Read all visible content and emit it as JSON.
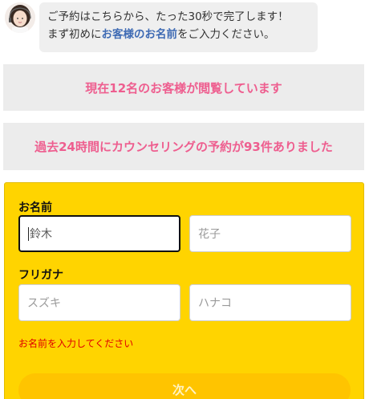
{
  "chat": {
    "avatar_icon": "operator-avatar-icon",
    "line1": "ご予約はこちらから、たった30秒で完了します！",
    "line2_prefix": "まず初めに",
    "line2_emphasis": "お客様のお名前",
    "line2_suffix": "をご入力ください。"
  },
  "notices": {
    "viewers": "現在12名のお客様が閲覧しています",
    "reservations": "過去24時間にカウンセリングの予約が93件ありました"
  },
  "form": {
    "name_label": "お名前",
    "last_name": {
      "value": "",
      "placeholder": "鈴木"
    },
    "first_name": {
      "value": "",
      "placeholder": "花子"
    },
    "kana_label": "フリガナ",
    "last_name_kana": {
      "value": "",
      "placeholder": "スズキ"
    },
    "first_name_kana": {
      "value": "",
      "placeholder": "ハナコ"
    },
    "error_message": "お名前を入力してください",
    "next_button": "次へ"
  },
  "colors": {
    "accent_pink": "#ee5e8f",
    "panel_yellow": "#ffd400",
    "button_yellow": "#ffc400",
    "emphasis_blue": "#3f6bb4",
    "error_red": "#e00000"
  }
}
